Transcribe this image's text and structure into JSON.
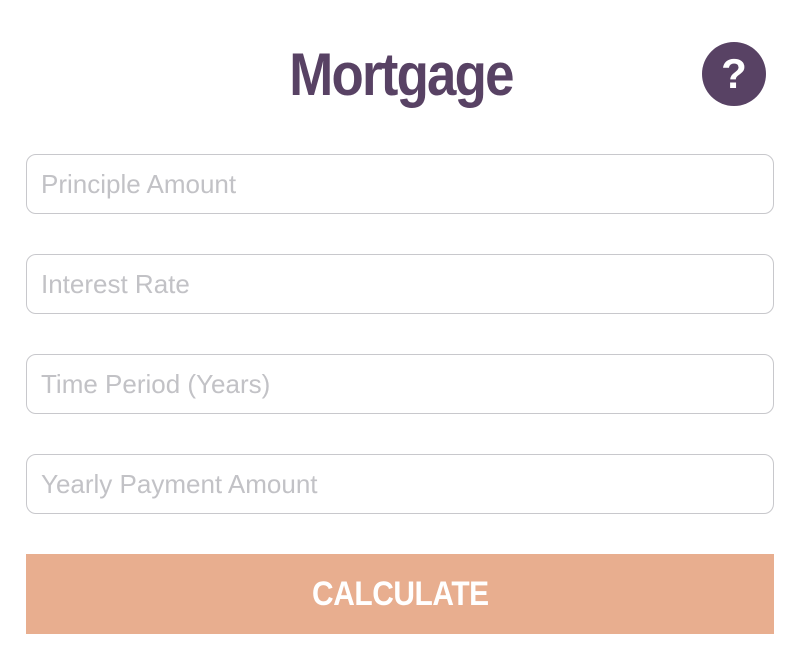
{
  "header": {
    "title": "Mortgage",
    "help_label": "?"
  },
  "form": {
    "fields": [
      {
        "placeholder": "Principle Amount",
        "value": ""
      },
      {
        "placeholder": "Interest Rate",
        "value": ""
      },
      {
        "placeholder": "Time Period (Years)",
        "value": ""
      },
      {
        "placeholder": "Yearly Payment Amount",
        "value": ""
      }
    ],
    "submit_label": "CALCULATE"
  },
  "colors": {
    "brand_purple": "#584264",
    "button_peach": "#e8ae8f",
    "field_border": "#c8c8cc",
    "placeholder_gray": "#c2c2c6"
  },
  "icons": {
    "help": "help-icon"
  }
}
